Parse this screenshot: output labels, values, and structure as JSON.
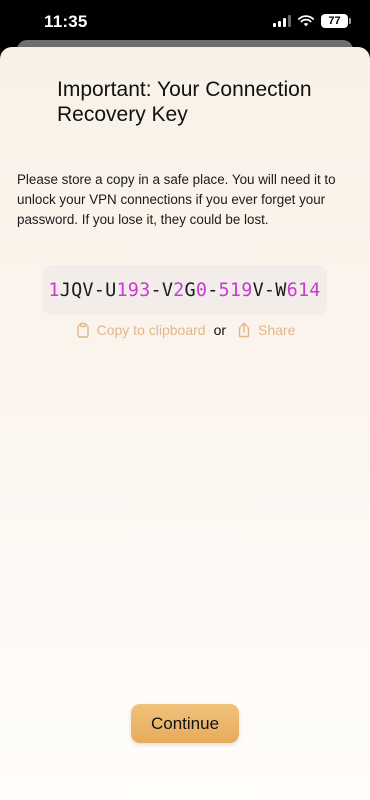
{
  "status_bar": {
    "time": "11:35",
    "battery": "77"
  },
  "sheet": {
    "title": "Important: Your Connection Recovery Key",
    "description": "Please store a copy in a safe place. You will need it to unlock your VPN connections if you ever forget your password. If you lose it, they could be lost.",
    "recovery_key": "1JQV-U193-V2G0-519V-W614",
    "copy_label": "Copy to clipboard",
    "or_label": "or",
    "share_label": "Share",
    "continue_label": "Continue"
  },
  "colors": {
    "digit_highlight": "#c93bd1",
    "accent": "#e0b78a",
    "button": "#eab46a"
  },
  "icons": [
    "signal-icon",
    "wifi-icon",
    "battery-icon",
    "clipboard-icon",
    "share-icon"
  ]
}
